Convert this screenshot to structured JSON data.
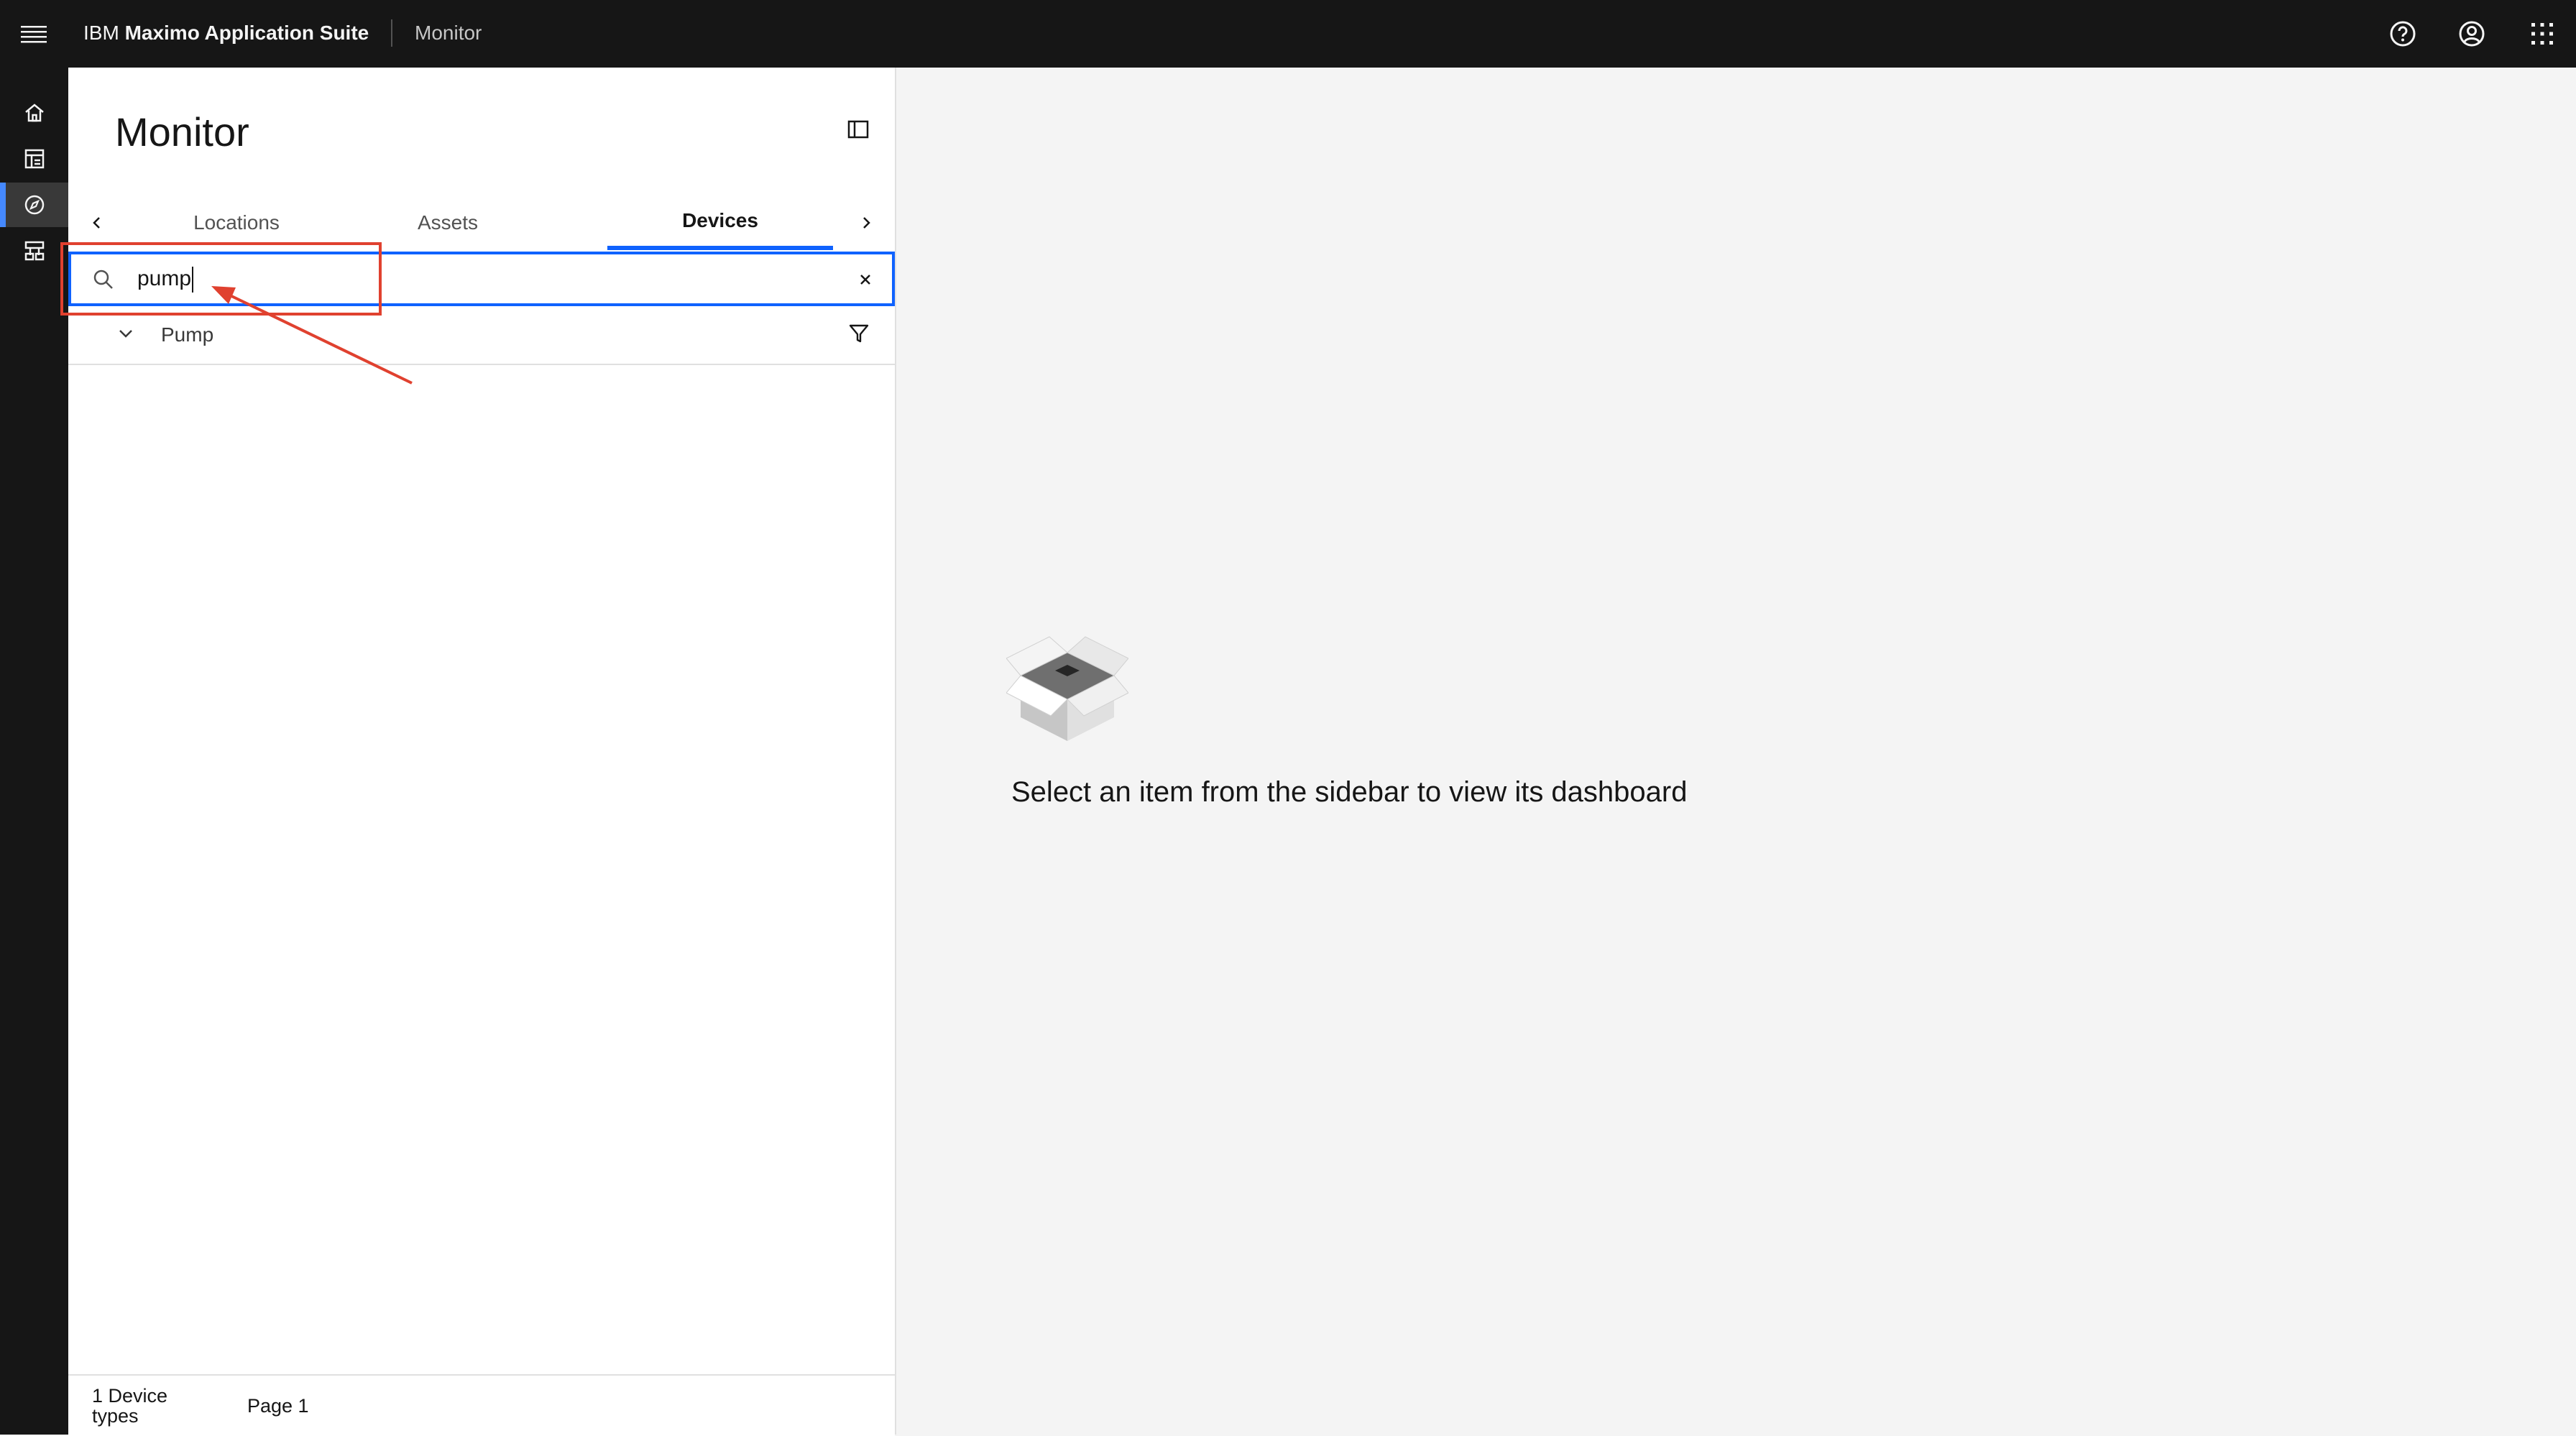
{
  "header": {
    "brand_prefix": "IBM",
    "brand_name": "Maximo Application Suite",
    "app_name": "Monitor",
    "icons": [
      "menu-icon",
      "help-icon",
      "user-avatar-icon",
      "app-switcher-icon"
    ]
  },
  "leftnav": {
    "items": [
      {
        "icon": "home-icon",
        "active": false
      },
      {
        "icon": "dashboard-icon",
        "active": false
      },
      {
        "icon": "compass-icon",
        "active": true
      },
      {
        "icon": "hierarchy-icon",
        "active": false
      }
    ]
  },
  "sidebar": {
    "title": "Monitor",
    "tabs": [
      {
        "label": "Locations",
        "active": false
      },
      {
        "label": "Assets",
        "active": false
      },
      {
        "label": "Devices",
        "active": true
      }
    ],
    "search": {
      "value": "pump"
    },
    "tree": [
      {
        "label": "Pump",
        "expanded": true
      }
    ],
    "footer": {
      "count_label": "1 Device types",
      "page_label": "Page 1"
    }
  },
  "main": {
    "empty_message": "Select an item from the sidebar to view its dashboard"
  },
  "colors": {
    "topbar": "#161616",
    "accent": "#0f62fe",
    "annotation": "#e0412f",
    "background": "#f4f4f4"
  }
}
